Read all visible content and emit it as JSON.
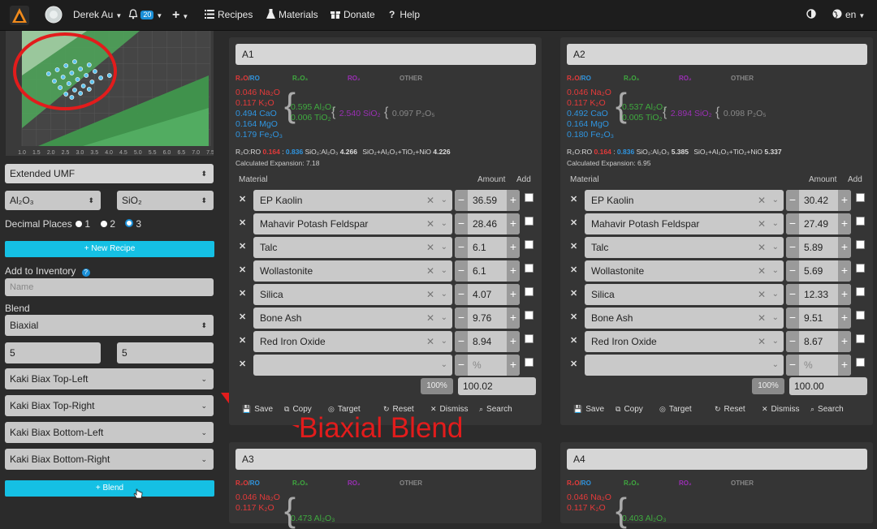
{
  "topbar": {
    "user": "Derek Au",
    "notifications": "20",
    "nav": [
      "Recipes",
      "Materials",
      "Donate",
      "Help"
    ],
    "lang": "en"
  },
  "chart_data": {
    "type": "scatter",
    "xlim": [
      1.0,
      7.5
    ],
    "x_ticks": [
      "1.0",
      "1.5",
      "2.0",
      "2.5",
      "3.0",
      "3.5",
      "4.0",
      "4.5",
      "5.0",
      "5.5",
      "6.0",
      "6.5",
      "7.0",
      "7.5"
    ],
    "points_note": "",
    "x": [
      2.2,
      2.5,
      2.8,
      3.1,
      2.4,
      2.7,
      3.0,
      3.3,
      3.6,
      2.6,
      2.9,
      3.2,
      3.5,
      3.8,
      2.8,
      3.1,
      3.4,
      3.7,
      4.0,
      4.3,
      3.0,
      3.3,
      3.6
    ],
    "grid": true
  },
  "sidebar": {
    "umf_select": "Extended UMF",
    "x_oxide": "Al₂O₃",
    "y_oxide": "SiO₂",
    "decimal_label": "Decimal Places",
    "decimal_options": [
      "1",
      "2",
      "3"
    ],
    "decimal_selected": "3",
    "new_recipe": "New Recipe",
    "add_inventory": "Add to Inventory",
    "name_placeholder": "Name",
    "blend_label": "Blend",
    "blend_type": "Biaxial",
    "blend_rows": "5",
    "blend_cols": "5",
    "corners": [
      "Kaki Biax Top-Left",
      "Kaki Biax Top-Right",
      "Kaki Biax Bottom-Left",
      "Kaki Biax Bottom-Right"
    ],
    "blend_button": "Blend"
  },
  "headers": {
    "r2o": "R₂O",
    "ro": "RO",
    "r2o3": "R₂O₃",
    "ro2": "RO₂",
    "other": "OTHER"
  },
  "labels": {
    "ratio_prefix": "R₂O:RO",
    "sio2_al2o3": "SiO₂:Al₂O₃",
    "sio2_total": "SiO₂+Al₂O₃+TiO₂+NiO",
    "material": "Material",
    "amount": "Amount",
    "add": "Add",
    "percent_placeholder": "%",
    "hundred": "100%",
    "actions": [
      "Save",
      "Copy",
      "Target",
      "Reset",
      "Dismiss",
      "Search"
    ]
  },
  "cards": [
    {
      "title": "A1",
      "r2o": [
        "0.046 Na₂O",
        "0.117 K₂O"
      ],
      "ro": [
        "0.494 CaO",
        "0.164 MgO",
        "0.179 Fe₂O₃"
      ],
      "r2o3": [
        "0.595 Al₂O₃",
        "0.006 TiO₂"
      ],
      "ro2": "2.540 SiO₂",
      "other": "0.097 P₂O₅",
      "ratio_r2o": "0.164",
      "ratio_ro": "0.836",
      "si_al": "4.266",
      "si_total": "4.226",
      "expansion": "Calculated Expansion: 7.18",
      "materials": [
        {
          "name": "EP Kaolin",
          "amount": "36.59"
        },
        {
          "name": "Mahavir Potash Feldspar",
          "amount": "28.46"
        },
        {
          "name": "Talc",
          "amount": "6.1"
        },
        {
          "name": "Wollastonite",
          "amount": "6.1"
        },
        {
          "name": "Silica",
          "amount": "4.07"
        },
        {
          "name": "Bone Ash",
          "amount": "9.76"
        },
        {
          "name": "Red Iron Oxide",
          "amount": "8.94"
        }
      ],
      "total": "100.02"
    },
    {
      "title": "A2",
      "r2o": [
        "0.046 Na₂O",
        "0.117 K₂O"
      ],
      "ro": [
        "0.492 CaO",
        "0.164 MgO",
        "0.180 Fe₂O₃"
      ],
      "r2o3": [
        "0.537 Al₂O₃",
        "0.005 TiO₂"
      ],
      "ro2": "2.894 SiO₂",
      "other": "0.098 P₂O₅",
      "ratio_r2o": "0.164",
      "ratio_ro": "0.836",
      "si_al": "5.385",
      "si_total": "5.337",
      "expansion": "Calculated Expansion: 6.95",
      "materials": [
        {
          "name": "EP Kaolin",
          "amount": "30.42"
        },
        {
          "name": "Mahavir Potash Feldspar",
          "amount": "27.49"
        },
        {
          "name": "Talc",
          "amount": "5.89"
        },
        {
          "name": "Wollastonite",
          "amount": "5.69"
        },
        {
          "name": "Silica",
          "amount": "12.33"
        },
        {
          "name": "Bone Ash",
          "amount": "9.51"
        },
        {
          "name": "Red Iron Oxide",
          "amount": "8.67"
        }
      ],
      "total": "100.00"
    },
    {
      "title": "A3",
      "r2o": [
        "0.046 Na₂O",
        "0.117 K₂O"
      ],
      "r2o3": [
        "0.473 Al₂O₃"
      ]
    },
    {
      "title": "A4",
      "r2o": [
        "0.046 Na₂O",
        "0.117 K₂O"
      ],
      "r2o3": [
        "0.403 Al₂O₃"
      ]
    }
  ],
  "annotation": "Biaxial Blend"
}
